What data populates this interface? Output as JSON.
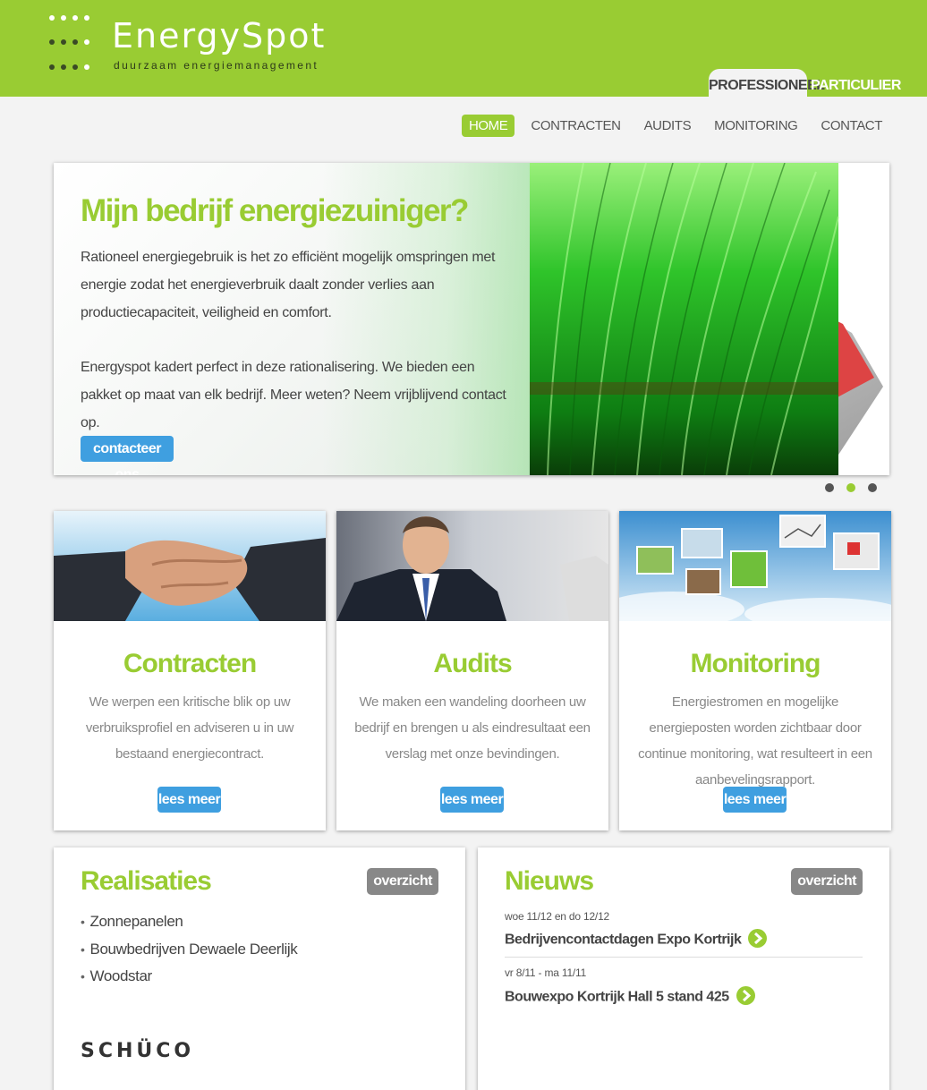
{
  "logo": {
    "name": "EnergySpot",
    "tagline": "duurzaam energiemanagement"
  },
  "audience_tabs": [
    {
      "label": "PROFESSIONEEL",
      "active": true
    },
    {
      "label": "PARTICULIER",
      "active": false
    }
  ],
  "nav": [
    {
      "label": "HOME",
      "active": true
    },
    {
      "label": "CONTRACTEN",
      "active": false
    },
    {
      "label": "AUDITS",
      "active": false
    },
    {
      "label": "MONITORING",
      "active": false
    },
    {
      "label": "CONTACT",
      "active": false
    }
  ],
  "hero": {
    "title": "Mijn bedrijf energiezuiniger?",
    "paragraph1": "Rationeel energiegebruik is het zo efficiënt mogelijk omspringen met energie zodat het energieverbruik daalt zonder verlies aan productiecapaciteit, veiligheid en comfort.",
    "paragraph2": "Energyspot kadert perfect in deze rationalisering. We bieden een pakket op maat van elk bedrijf. Meer weten? Neem vrijblijvend contact op.",
    "button": "contacteer ons",
    "slides": 3,
    "active_slide": 2
  },
  "cards": [
    {
      "title": "Contracten",
      "text": "We werpen een kritische blik op uw verbruiksprofiel en adviseren u in uw bestaand energiecontract.",
      "button": "lees meer"
    },
    {
      "title": "Audits",
      "text": "We maken een wandeling doorheen uw bedrijf en brengen u als eindresultaat een verslag met onze bevindingen.",
      "button": "lees meer"
    },
    {
      "title": "Monitoring",
      "text": "Energiestromen en mogelijke energieposten worden zichtbaar door continue monitoring, wat resulteert in een aanbevelingsrapport.",
      "button": "lees meer"
    }
  ],
  "realisaties": {
    "title": "Realisaties",
    "button": "overzicht",
    "items": [
      "Zonnepanelen",
      "Bouwbedrijven Dewaele Deerlijk",
      "Woodstar"
    ],
    "partner_logo": "SCHÜCO"
  },
  "nieuws": {
    "title": "Nieuws",
    "button": "overzicht",
    "items": [
      {
        "date": "woe 11/12 en do 12/12",
        "title": "Bedrijvencontactdagen Expo Kortrijk"
      },
      {
        "date": "vr 8/11 - ma 11/11",
        "title": "Bouwexpo Kortrijk Hall 5 stand 425"
      }
    ]
  },
  "colors": {
    "brand_green": "#99cc33",
    "button_blue": "#3f9fe0",
    "button_grey": "#888888",
    "page_bg": "#f3f3f3"
  }
}
